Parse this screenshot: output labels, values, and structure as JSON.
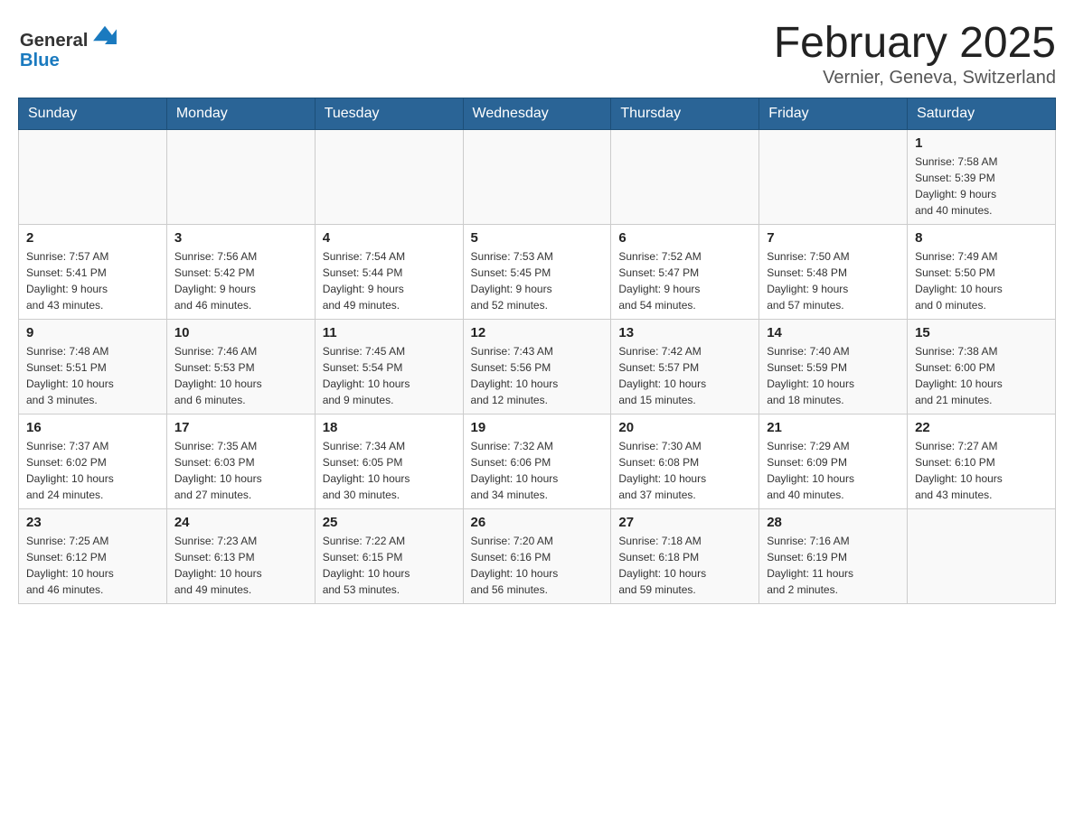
{
  "header": {
    "logo_general": "General",
    "logo_blue": "Blue",
    "month_title": "February 2025",
    "location": "Vernier, Geneva, Switzerland"
  },
  "days_of_week": [
    "Sunday",
    "Monday",
    "Tuesday",
    "Wednesday",
    "Thursday",
    "Friday",
    "Saturday"
  ],
  "weeks": [
    [
      {
        "day": "",
        "info": ""
      },
      {
        "day": "",
        "info": ""
      },
      {
        "day": "",
        "info": ""
      },
      {
        "day": "",
        "info": ""
      },
      {
        "day": "",
        "info": ""
      },
      {
        "day": "",
        "info": ""
      },
      {
        "day": "1",
        "info": "Sunrise: 7:58 AM\nSunset: 5:39 PM\nDaylight: 9 hours\nand 40 minutes."
      }
    ],
    [
      {
        "day": "2",
        "info": "Sunrise: 7:57 AM\nSunset: 5:41 PM\nDaylight: 9 hours\nand 43 minutes."
      },
      {
        "day": "3",
        "info": "Sunrise: 7:56 AM\nSunset: 5:42 PM\nDaylight: 9 hours\nand 46 minutes."
      },
      {
        "day": "4",
        "info": "Sunrise: 7:54 AM\nSunset: 5:44 PM\nDaylight: 9 hours\nand 49 minutes."
      },
      {
        "day": "5",
        "info": "Sunrise: 7:53 AM\nSunset: 5:45 PM\nDaylight: 9 hours\nand 52 minutes."
      },
      {
        "day": "6",
        "info": "Sunrise: 7:52 AM\nSunset: 5:47 PM\nDaylight: 9 hours\nand 54 minutes."
      },
      {
        "day": "7",
        "info": "Sunrise: 7:50 AM\nSunset: 5:48 PM\nDaylight: 9 hours\nand 57 minutes."
      },
      {
        "day": "8",
        "info": "Sunrise: 7:49 AM\nSunset: 5:50 PM\nDaylight: 10 hours\nand 0 minutes."
      }
    ],
    [
      {
        "day": "9",
        "info": "Sunrise: 7:48 AM\nSunset: 5:51 PM\nDaylight: 10 hours\nand 3 minutes."
      },
      {
        "day": "10",
        "info": "Sunrise: 7:46 AM\nSunset: 5:53 PM\nDaylight: 10 hours\nand 6 minutes."
      },
      {
        "day": "11",
        "info": "Sunrise: 7:45 AM\nSunset: 5:54 PM\nDaylight: 10 hours\nand 9 minutes."
      },
      {
        "day": "12",
        "info": "Sunrise: 7:43 AM\nSunset: 5:56 PM\nDaylight: 10 hours\nand 12 minutes."
      },
      {
        "day": "13",
        "info": "Sunrise: 7:42 AM\nSunset: 5:57 PM\nDaylight: 10 hours\nand 15 minutes."
      },
      {
        "day": "14",
        "info": "Sunrise: 7:40 AM\nSunset: 5:59 PM\nDaylight: 10 hours\nand 18 minutes."
      },
      {
        "day": "15",
        "info": "Sunrise: 7:38 AM\nSunset: 6:00 PM\nDaylight: 10 hours\nand 21 minutes."
      }
    ],
    [
      {
        "day": "16",
        "info": "Sunrise: 7:37 AM\nSunset: 6:02 PM\nDaylight: 10 hours\nand 24 minutes."
      },
      {
        "day": "17",
        "info": "Sunrise: 7:35 AM\nSunset: 6:03 PM\nDaylight: 10 hours\nand 27 minutes."
      },
      {
        "day": "18",
        "info": "Sunrise: 7:34 AM\nSunset: 6:05 PM\nDaylight: 10 hours\nand 30 minutes."
      },
      {
        "day": "19",
        "info": "Sunrise: 7:32 AM\nSunset: 6:06 PM\nDaylight: 10 hours\nand 34 minutes."
      },
      {
        "day": "20",
        "info": "Sunrise: 7:30 AM\nSunset: 6:08 PM\nDaylight: 10 hours\nand 37 minutes."
      },
      {
        "day": "21",
        "info": "Sunrise: 7:29 AM\nSunset: 6:09 PM\nDaylight: 10 hours\nand 40 minutes."
      },
      {
        "day": "22",
        "info": "Sunrise: 7:27 AM\nSunset: 6:10 PM\nDaylight: 10 hours\nand 43 minutes."
      }
    ],
    [
      {
        "day": "23",
        "info": "Sunrise: 7:25 AM\nSunset: 6:12 PM\nDaylight: 10 hours\nand 46 minutes."
      },
      {
        "day": "24",
        "info": "Sunrise: 7:23 AM\nSunset: 6:13 PM\nDaylight: 10 hours\nand 49 minutes."
      },
      {
        "day": "25",
        "info": "Sunrise: 7:22 AM\nSunset: 6:15 PM\nDaylight: 10 hours\nand 53 minutes."
      },
      {
        "day": "26",
        "info": "Sunrise: 7:20 AM\nSunset: 6:16 PM\nDaylight: 10 hours\nand 56 minutes."
      },
      {
        "day": "27",
        "info": "Sunrise: 7:18 AM\nSunset: 6:18 PM\nDaylight: 10 hours\nand 59 minutes."
      },
      {
        "day": "28",
        "info": "Sunrise: 7:16 AM\nSunset: 6:19 PM\nDaylight: 11 hours\nand 2 minutes."
      },
      {
        "day": "",
        "info": ""
      }
    ]
  ]
}
